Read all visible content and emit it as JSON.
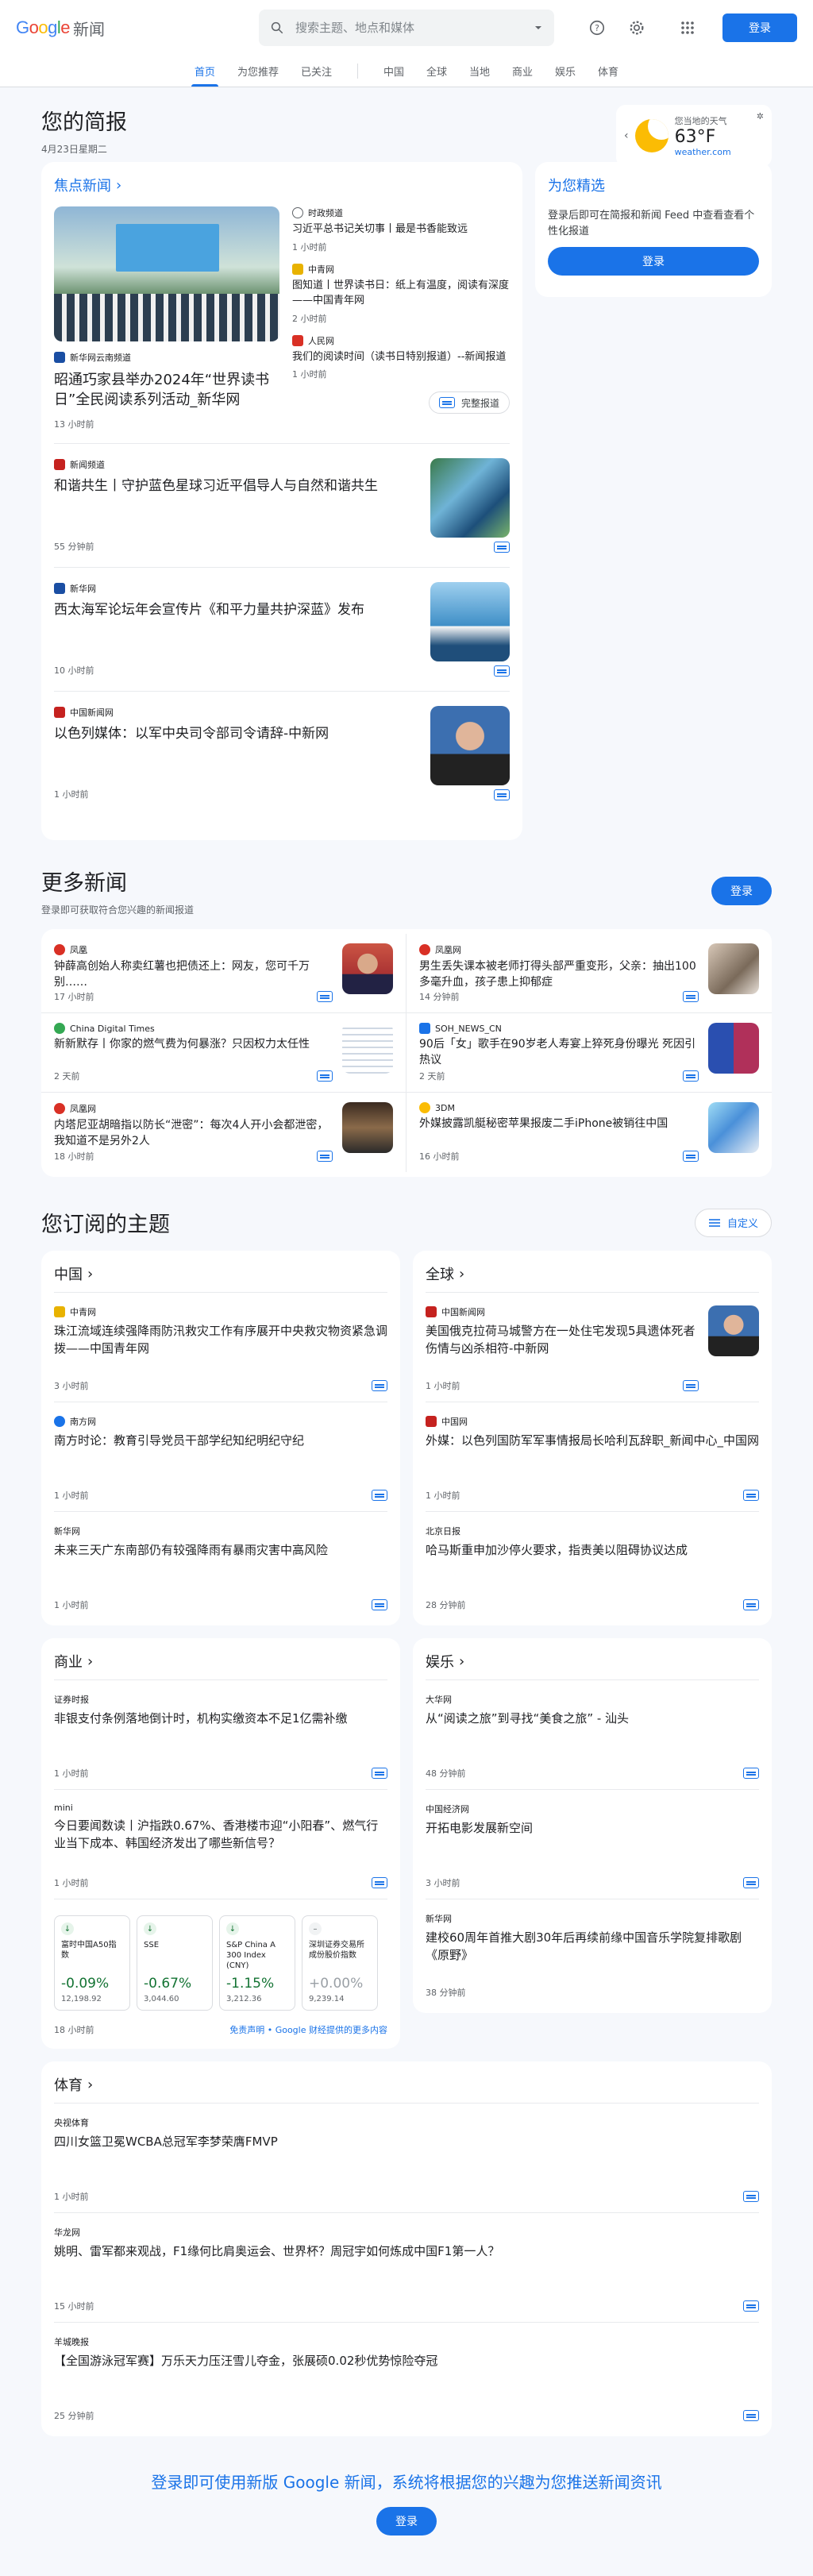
{
  "header": {
    "logo": "Google",
    "logo_suffix": "新闻",
    "search_placeholder": "搜索主题、地点和媒体",
    "login_label": "登录"
  },
  "nav": {
    "tabs": [
      "首页",
      "为您推荐",
      "已关注"
    ],
    "sections": [
      "中国",
      "全球",
      "当地",
      "商业",
      "娱乐",
      "体育"
    ]
  },
  "brief": {
    "title": "您的简报",
    "date": "4月23日星期二"
  },
  "weather": {
    "label": "您当地的天气",
    "temp": "63°F",
    "source": "weather.com"
  },
  "headlines": {
    "title": "焦点新闻",
    "full_coverage": "完整报道",
    "main": {
      "source": "新华网云南频道",
      "title": "昭通巧家县举办2024年“世界读书日”全民阅读系列活动_新华网",
      "time": "13 小时前"
    },
    "side": [
      {
        "source": "时政频道",
        "title": "习近平总书记关切事丨最是书香能致远",
        "time": "1 小时前"
      },
      {
        "source": "中青网",
        "title": "图知道丨世界读书日：纸上有温度，阅读有深度——中国青年网",
        "time": "2 小时前"
      },
      {
        "source": "人民网",
        "title": "我们的阅读时间（读书日特别报道）--新闻报道",
        "time": "1 小时前"
      }
    ],
    "items": [
      {
        "source": "新闻频道",
        "title": "和谐共生丨守护蓝色星球习近平倡导人与自然和谐共生",
        "time": "55 分钟前"
      },
      {
        "source": "新华网",
        "title": "西太海军论坛年会宣传片《和平力量共护深蓝》发布",
        "time": "10 小时前"
      },
      {
        "source": "中国新闻网",
        "title": "以色列媒体：以军中央司令部司令请辞-中新网",
        "time": "1 小时前"
      }
    ]
  },
  "picks": {
    "title": "为您精选",
    "desc": "登录后即可在简报和新闻 Feed 中查看查看个性化报道",
    "button": "登录"
  },
  "more_news": {
    "title": "更多新闻",
    "subtitle": "登录即可获取符合您兴趣的新闻报道",
    "button": "登录",
    "items": [
      {
        "source": "凤凰",
        "title": "钟薛高创始人称卖红薯也把债还上：网友，您可千万别……",
        "time": "17 小时前"
      },
      {
        "source": "凤凰网",
        "title": "男生丢失课本被老师打得头部严重变形，父亲：抽出100多毫升血，孩子患上抑郁症",
        "time": "14 分钟前"
      },
      {
        "source": "China Digital Times",
        "title": "新新默存丨你家的燃气费为何暴涨？只因权力太任性",
        "time": "2 天前"
      },
      {
        "source": "SOH_NEWS_CN",
        "title": "90后「女」歌手在90岁老人寿宴上猝死身份曝光 死因引热议",
        "time": "2 天前"
      },
      {
        "source": "凤凰网",
        "title": "内塔尼亚胡暗指以防长“泄密”：每次4人开小会都泄密，我知道不是另外2人",
        "time": "18 小时前"
      },
      {
        "source": "3DM",
        "title": "外媒披露凯艇秘密苹果报废二手iPhone被销往中国",
        "time": "16 小时前"
      }
    ]
  },
  "topics": {
    "title": "您订阅的主题",
    "customize": "自定义",
    "china": {
      "title": "中国",
      "items": [
        {
          "source": "中青网",
          "title": "珠江流域连续强降雨防汛救灾工作有序展开中央救灾物资紧急调拨——中国青年网",
          "time": "3 小时前"
        },
        {
          "source": "南方网",
          "title": "南方时论：教育引导党员干部学纪知纪明纪守纪",
          "time": "1 小时前"
        },
        {
          "source": "新华网",
          "title": "未来三天广东南部仍有较强降雨有暴雨灾害中高风险",
          "time": "1 小时前"
        }
      ]
    },
    "world": {
      "title": "全球",
      "items": [
        {
          "source": "中国新闻网",
          "title": "美国俄克拉荷马城警方在一处住宅发现5具遗体死者伤情与凶杀相符-中新网",
          "time": "1 小时前"
        },
        {
          "source": "中国网",
          "title": "外媒：以色列国防军军事情报局长哈利瓦辞职_新闻中心_中国网",
          "time": "1 小时前"
        },
        {
          "source": "北京日报",
          "title": "哈马斯重申加沙停火要求，指责美以阻碍协议达成",
          "time": "28 分钟前"
        }
      ]
    },
    "business": {
      "title": "商业",
      "items": [
        {
          "source": "证券时报",
          "title": "非银支付条例落地倒计时，机构实缴资本不足1亿需补缴",
          "time": "1 小时前"
        },
        {
          "source": "mini",
          "title": "今日要闻数读丨沪指跌0.67%、香港楼市迎“小阳春”、燃气行业当下成本、韩国经济发出了哪些新信号？",
          "time": "1 小时前"
        }
      ],
      "stocks": [
        {
          "name": "富时中国A50指数",
          "change": "-0.09%",
          "price": "12,198.92"
        },
        {
          "name": "SSE",
          "change": "-0.67%",
          "price": "3,044.60"
        },
        {
          "name": "S&P China A 300 Index (CNY)",
          "change": "-1.15%",
          "price": "3,212.36"
        },
        {
          "name": "深圳证券交易所成份股价指数",
          "change": "+0.00%",
          "price": "9,239.14"
        }
      ],
      "stock_time": "18 小时前",
      "disclaimer": "免责声明 • Google 财经提供的更多内容"
    },
    "entertainment": {
      "title": "娱乐",
      "items": [
        {
          "source": "大华网",
          "title": "从“阅读之旅”到寻找“美食之旅” - 汕头",
          "time": "48 分钟前"
        },
        {
          "source": "中国经济网",
          "title": "开拓电影发展新空间",
          "time": "3 小时前"
        },
        {
          "source": "新华网",
          "title": "建校60周年首推大剧30年后再续前缘中国音乐学院复排歌剧《原野》",
          "time": "38 分钟前"
        }
      ]
    },
    "sports": {
      "title": "体育",
      "items": [
        {
          "source": "央视体育",
          "title": "四川女篮卫冕WCBA总冠军李梦荣膺FMVP",
          "time": "1 小时前"
        },
        {
          "source": "华龙网",
          "title": "姚明、雷军都来观战，F1缘何比肩奥运会、世界杯？周冠宇如何炼成中国F1第一人？",
          "time": "15 小时前"
        },
        {
          "source": "羊城晚报",
          "title": "【全国游泳冠军赛】万乐天力压汪雪儿夺金，张展硕0.02秒优势惊险夺冠",
          "time": "25 分钟前"
        }
      ]
    }
  },
  "bottom": {
    "message": "登录即可使用新版 Google 新闻，系统将根据您的兴趣为您推送新闻资讯",
    "button": "登录"
  },
  "colors": {
    "accent": "#1a73e8",
    "positive": "#137333",
    "background": "#f6f8fc"
  }
}
